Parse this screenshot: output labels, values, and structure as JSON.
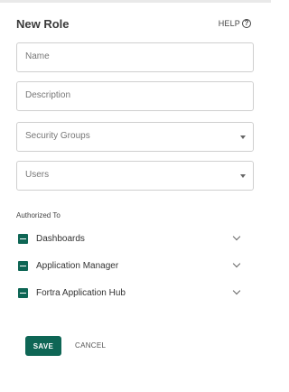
{
  "header": {
    "title": "New Role",
    "help_label": "HELP",
    "help_icon": "question-circle-icon"
  },
  "fields": {
    "name_placeholder": "Name",
    "description_placeholder": "Description",
    "security_groups_placeholder": "Security Groups",
    "users_placeholder": "Users"
  },
  "authorized": {
    "label": "Authorized To",
    "items": [
      {
        "label": "Dashboards"
      },
      {
        "label": "Application Manager"
      },
      {
        "label": "Fortra Application Hub"
      }
    ]
  },
  "actions": {
    "save_label": "SAVE",
    "cancel_label": "CANCEL"
  },
  "colors": {
    "accent": "#0e6655"
  }
}
